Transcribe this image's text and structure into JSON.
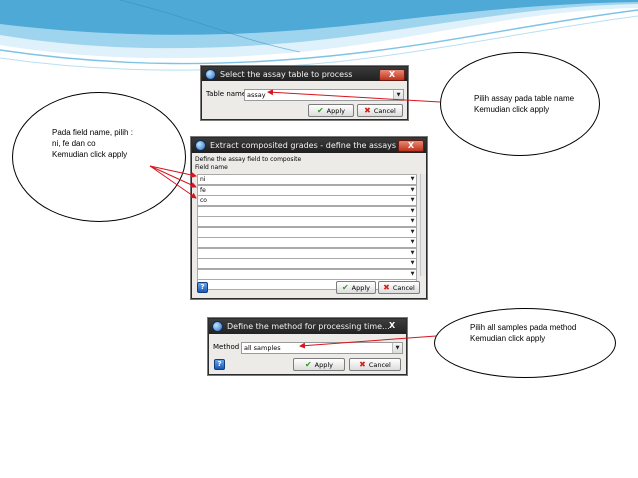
{
  "dialog1": {
    "title": "Select the assay table to process",
    "close": "X",
    "table_name_label": "Table name",
    "table_name_value": "assay",
    "apply": "Apply",
    "cancel": "Cancel"
  },
  "dialog2": {
    "title": "Extract composited grades - define the assays",
    "close": "X",
    "instruction": "Define the assay field to composite",
    "field_name_label": "Field name",
    "fields": [
      "ni",
      "fe",
      "co",
      "",
      "",
      "",
      "",
      "",
      "",
      "",
      ""
    ],
    "help": "?",
    "apply": "Apply",
    "cancel": "Cancel"
  },
  "dialog3": {
    "title": "Define the method for processing time...",
    "close": "X",
    "method_label": "Method",
    "method_value": "all samples",
    "help": "?",
    "apply": "Apply",
    "cancel": "Cancel"
  },
  "callouts": {
    "table": {
      "line1": "Pilih assay pada table name",
      "line2": "Kemudian click apply"
    },
    "fields": {
      "line1": "Pada field name, pilih :",
      "line2": "ni, fe dan co",
      "line3": "Kemudian click apply"
    },
    "method": {
      "line1": "Pilih all samples pada method",
      "line2": "Kemudian click apply"
    }
  },
  "colors": {
    "arrow": "#d8141e",
    "swoosh_blue": "#4fa9d6",
    "swoosh_light": "#bfe4f5"
  },
  "icons": {
    "apply": "check-icon",
    "cancel": "x-icon",
    "help": "question-icon"
  }
}
